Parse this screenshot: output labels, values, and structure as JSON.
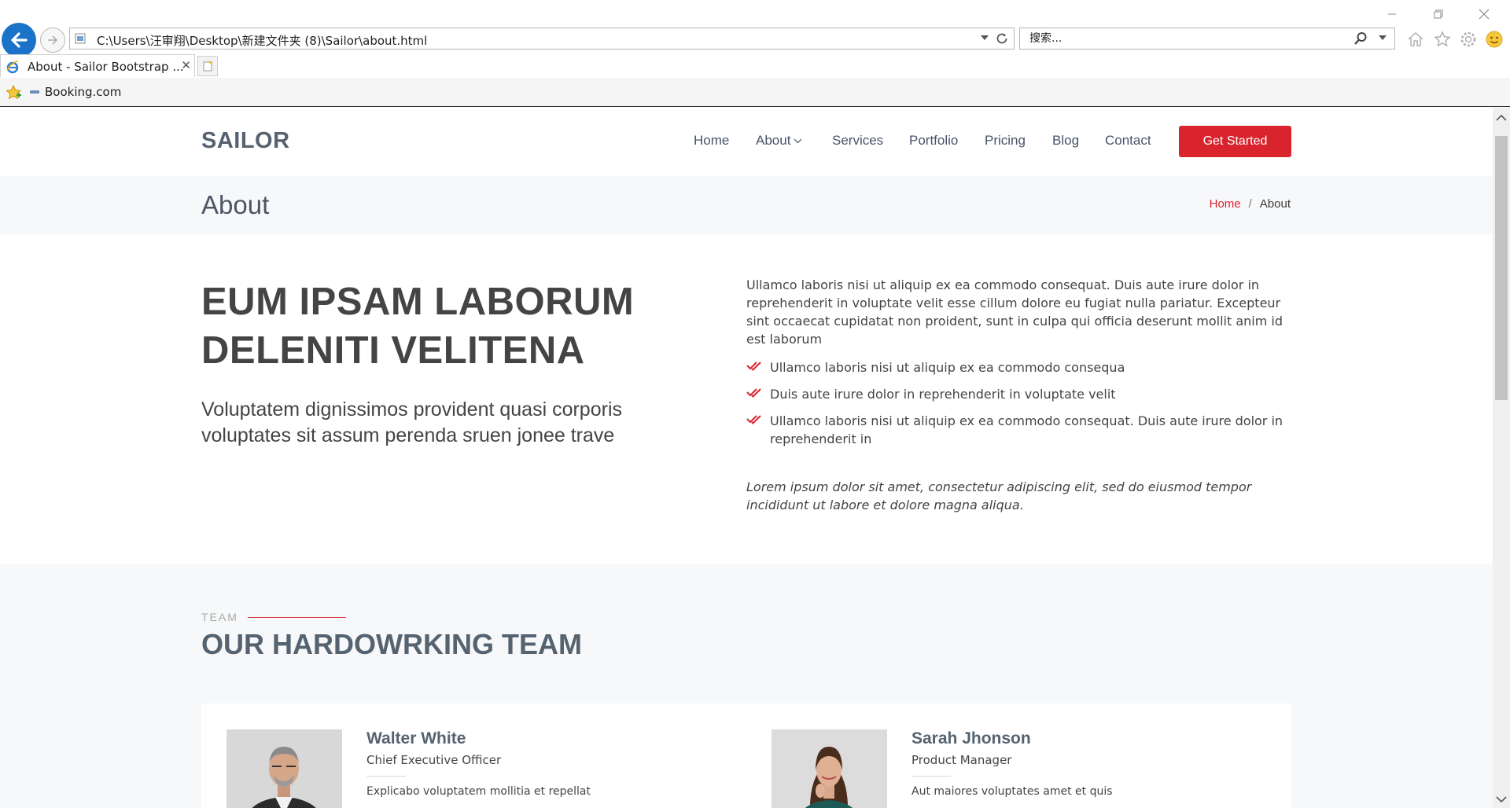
{
  "browser": {
    "address": "C:\\Users\\汪审翔\\Desktop\\新建文件夹 (8)\\Sailor\\about.html",
    "search_placeholder": "搜索...",
    "tab_title": "About - Sailor Bootstrap ...",
    "favorites": [
      {
        "label": "Booking.com"
      }
    ],
    "icons": [
      "back-arrow-icon",
      "forward-arrow-icon",
      "refresh-icon",
      "search-icon",
      "home-icon",
      "star-icon",
      "gear-icon",
      "smiley-icon"
    ]
  },
  "site": {
    "logo": "SAILOR",
    "nav": [
      "Home",
      "About",
      "Services",
      "Portfolio",
      "Pricing",
      "Blog",
      "Contact"
    ],
    "cta": "Get Started",
    "accent_color": "#d9232d"
  },
  "page_header": {
    "title": "About",
    "breadcrumb": {
      "home": "Home",
      "sep": "/",
      "current": "About"
    }
  },
  "about": {
    "heading": "EUM IPSAM LABORUM DELENITI VELITENA",
    "subheading": "Voluptatem dignissimos provident quasi corporis voluptates sit assum perenda sruen jonee trave",
    "intro": "Ullamco laboris nisi ut aliquip ex ea commodo consequat. Duis aute irure dolor in reprehenderit in voluptate velit esse cillum dolore eu fugiat nulla pariatur. Excepteur sint occaecat cupidatat non proident, sunt in culpa qui officia deserunt mollit anim id est laborum",
    "bullets": [
      "Ullamco laboris nisi ut aliquip ex ea commodo consequa",
      "Duis aute irure dolor in reprehenderit in voluptate velit",
      "Ullamco laboris nisi ut aliquip ex ea commodo consequat. Duis aute irure dolor in reprehenderit in"
    ],
    "closing": "Lorem ipsum dolor sit amet, consectetur adipiscing elit, sed do eiusmod tempor incididunt ut labore et dolore magna aliqua."
  },
  "team": {
    "label": "TEAM",
    "heading": "OUR HARDOWRKING TEAM",
    "members": [
      {
        "name": "Walter White",
        "role": "Chief Executive Officer",
        "bio": "Explicabo voluptatem mollitia et repellat"
      },
      {
        "name": "Sarah Jhonson",
        "role": "Product Manager",
        "bio": "Aut maiores voluptates amet et quis"
      }
    ]
  }
}
